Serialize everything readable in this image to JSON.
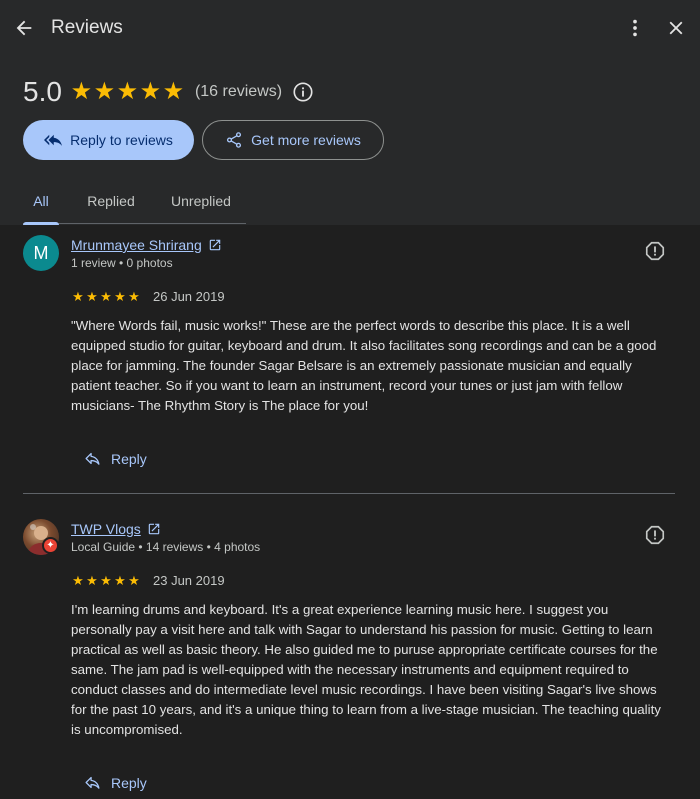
{
  "header": {
    "title": "Reviews",
    "back_icon": "arrow-left-icon",
    "more_icon": "more-vert-icon",
    "close_icon": "close-icon"
  },
  "summary": {
    "rating": "5.0",
    "stars": 5,
    "count_text": "(16 reviews)",
    "star_color": "#fbbc04"
  },
  "actions": {
    "reply_label": "Reply to reviews",
    "get_more_label": "Get more reviews"
  },
  "tabs": [
    {
      "label": "All",
      "active": true
    },
    {
      "label": "Replied",
      "active": false
    },
    {
      "label": "Unreplied",
      "active": false
    }
  ],
  "reviews": [
    {
      "avatar_letter": "M",
      "name": "Mrunmayee Shrirang",
      "meta": "1 review • 0 photos",
      "stars": 5,
      "date": "26 Jun 2019",
      "text": "\"Where Words fail, music works!\" These are the perfect words to describe this place. It is a well equipped studio for guitar, keyboard and drum. It also facilitates song recordings and can be a good place for jamming. The founder Sagar Belsare is an extremely passionate musician and equally patient teacher. So if you want to learn an instrument, record your tunes or just jam with fellow musicians- The Rhythm Story is The place for you!",
      "reply_label": "Reply"
    },
    {
      "avatar_letter": "",
      "name": "TWP Vlogs",
      "meta": "Local Guide • 14 reviews • 4 photos",
      "stars": 5,
      "date": "23 Jun 2019",
      "text": "I'm learning drums and keyboard. It's a great experience learning music here. I suggest you personally pay a visit here and talk with Sagar to understand his passion for music. Getting to learn practical as well as basic theory. He also guided me to puruse appropriate certificate courses for the same. The jam pad is well-equipped with the necessary instruments and equipment required to conduct classes and do intermediate level music recordings. I have been visiting Sagar's live shows for the past 10 years, and it's a unique thing to learn from a live-stage musician. The teaching quality is uncompromised.",
      "reply_label": "Reply"
    }
  ],
  "colors": {
    "accent": "#a8c7fa",
    "background": "#1f1f1f",
    "header_background": "#28292a"
  }
}
